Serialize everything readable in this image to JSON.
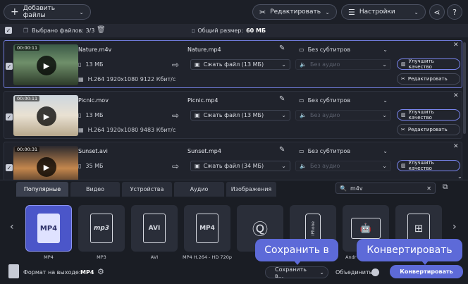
{
  "toolbar": {
    "add_files_label": "Добавить файлы",
    "edit_label": "Редактировать",
    "settings_label": "Настройки",
    "help_label": "?"
  },
  "selection_bar": {
    "selected_label": "Выбрано файлов: 3/3",
    "total_size_label": "Общий размер:",
    "total_size_value": "60 МБ"
  },
  "files": [
    {
      "duration": "00:00:11",
      "name": "Nature.m4v",
      "size": "13 МБ",
      "codec": "H.264 1920x1080 9122 Кбит/с",
      "output_name": "Nature.mp4",
      "compress": "Сжать файл (13 МБ)",
      "subtitles": "Без субтитров",
      "audio": "Без аудио",
      "enhance": "Улучшить качество",
      "edit": "Редактировать"
    },
    {
      "duration": "00:00:11",
      "name": "Picnic.mov",
      "size": "13 МБ",
      "codec": "H.264 1920x1080 9483 Кбит/с",
      "output_name": "Picnic.mp4",
      "compress": "Сжать файл (13 МБ)",
      "subtitles": "Без субтитров",
      "audio": "Без аудио",
      "enhance": "Улучшить качество",
      "edit": "Редактировать"
    },
    {
      "duration": "00:00:31",
      "name": "Sunset.avi",
      "size": "35 МБ",
      "codec": "",
      "output_name": "Sunset.mp4",
      "compress": "Сжать файл (34 МБ)",
      "subtitles": "Без субтитров",
      "audio": "Без аудио",
      "enhance": "Улучшить качество",
      "edit": ""
    }
  ],
  "format_tabs": [
    "Популярные",
    "Видео",
    "Устройства",
    "Аудио",
    "Изображения"
  ],
  "search": {
    "value": "m4v"
  },
  "formats": [
    {
      "icon_text": "MP4",
      "label": "MP4"
    },
    {
      "icon_text": "mp3",
      "label": "MP3"
    },
    {
      "icon_text": "AVI",
      "label": "AVI"
    },
    {
      "icon_text": "MP4",
      "label": "MP4 H.264 - HD 720p"
    },
    {
      "icon_text": "",
      "label": ""
    },
    {
      "icon_text": "iPhone",
      "label": ""
    },
    {
      "icon_text": "",
      "label": "Andr"
    },
    {
      "icon_text": "",
      "label": ""
    }
  ],
  "bottom": {
    "output_format_label": "Формат на выходе:",
    "output_format_value": "MP4",
    "save_to_label": "Сохранить в...",
    "merge_label": "Объединить:",
    "convert_label": "Конвертировать"
  },
  "tooltips": {
    "save_to": "Сохранить в",
    "convert": "Конвертировать"
  },
  "colors": {
    "background": "#1c1f27",
    "accent": "#5d6ad8",
    "selected_border": "#6f7ad8"
  }
}
